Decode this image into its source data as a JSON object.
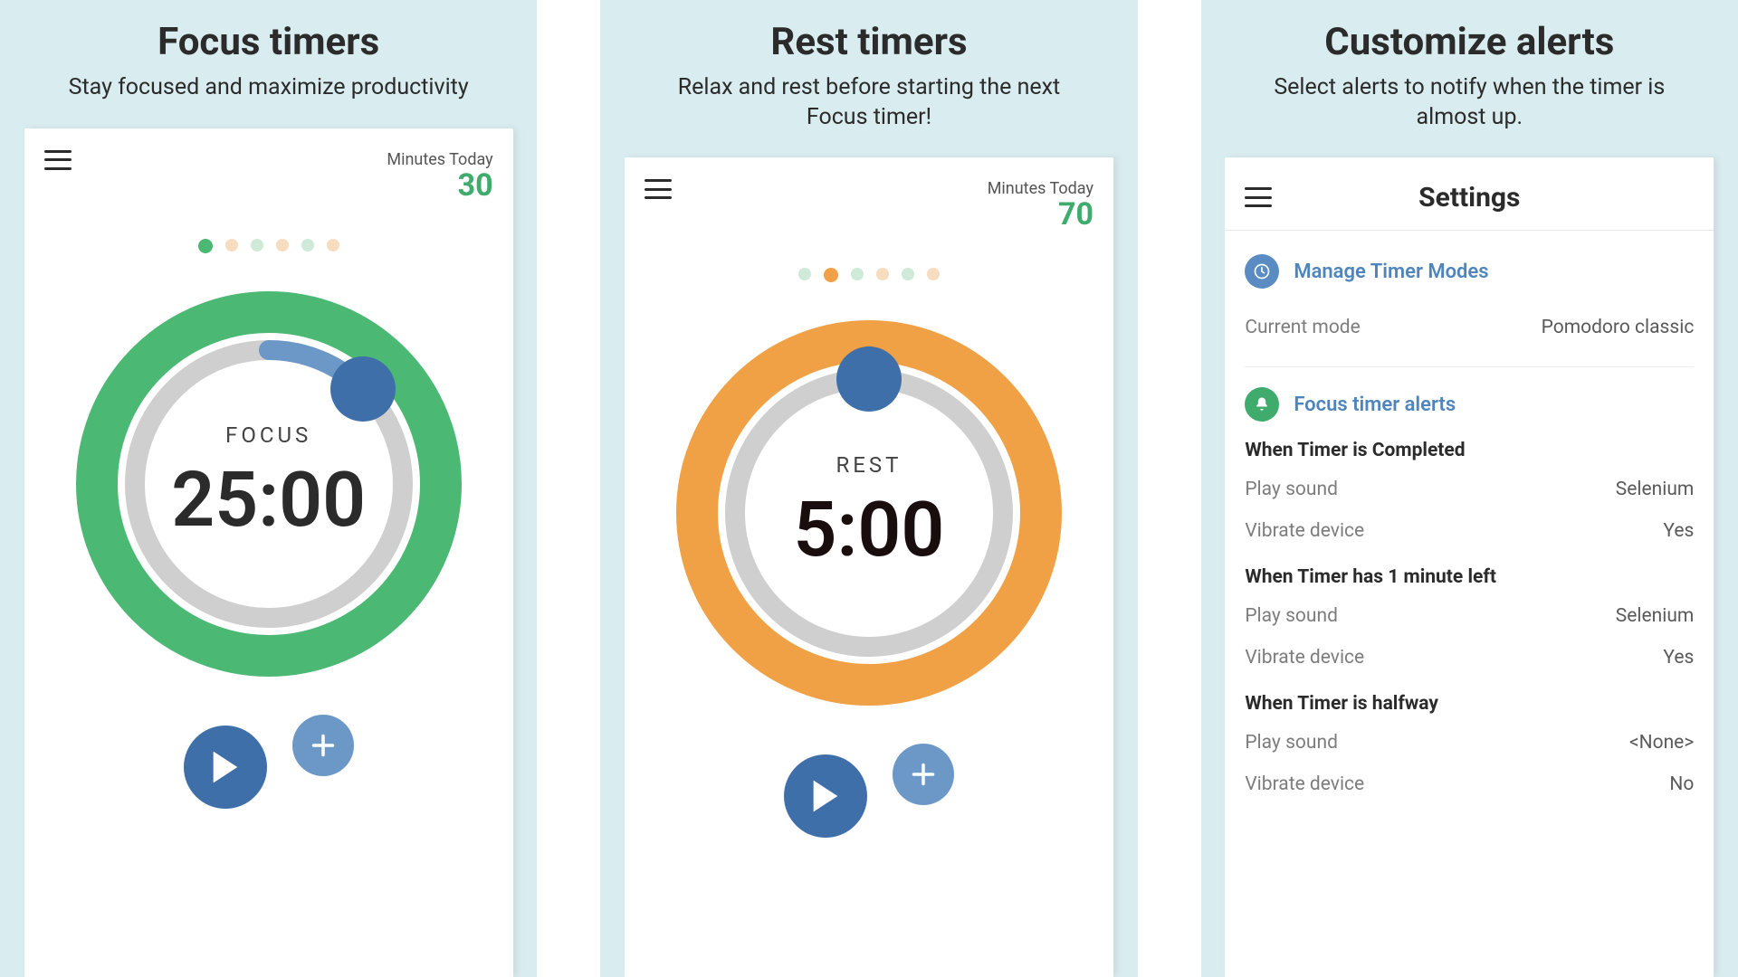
{
  "colors": {
    "green": "#4bb874",
    "orange": "#f0a146",
    "grey": "#cfcfcf",
    "blue": "#3f6fa8",
    "blueLight": "#6b98c6",
    "dotFadeGreen": "#cfead8",
    "dotFadeOrange": "#f7dcc0"
  },
  "panels": [
    {
      "title": "Focus timers",
      "subtitle": "Stay focused and maximize productivity",
      "minutesLabel": "Minutes Today",
      "minutesValue": "30",
      "dots": [
        "green",
        "fadeOrange",
        "fadeGreen",
        "fadeOrange",
        "fadeGreen",
        "fadeOrange"
      ],
      "timer": {
        "mode": "FOCUS",
        "time": "25:00",
        "ringColor": "green",
        "arcStart": 0,
        "arcEnd": 45,
        "knobDeg": 45
      }
    },
    {
      "title": "Rest timers",
      "subtitle": "Relax and rest before starting the next Focus timer!",
      "minutesLabel": "Minutes Today",
      "minutesValue": "70",
      "dots": [
        "fadeGreen",
        "orange",
        "fadeGreen",
        "fadeOrange",
        "fadeGreen",
        "fadeOrange"
      ],
      "timer": {
        "mode": "REST",
        "time": "5:00",
        "ringColor": "orange",
        "arcStart": 0,
        "arcEnd": 0,
        "knobDeg": 0
      }
    },
    {
      "title": "Customize alerts",
      "subtitle": "Select alerts to notify when the timer is almost up.",
      "settings": {
        "title": "Settings",
        "manage": {
          "link": "Manage Timer Modes",
          "label": "Current mode",
          "value": "Pomodoro classic"
        },
        "alerts": {
          "link": "Focus timer alerts",
          "groups": [
            {
              "heading": "When Timer is Completed",
              "rows": [
                {
                  "label": "Play sound",
                  "value": "Selenium"
                },
                {
                  "label": "Vibrate device",
                  "value": "Yes"
                }
              ]
            },
            {
              "heading": "When Timer has 1 minute left",
              "rows": [
                {
                  "label": "Play sound",
                  "value": "Selenium"
                },
                {
                  "label": "Vibrate device",
                  "value": "Yes"
                }
              ]
            },
            {
              "heading": "When Timer is halfway",
              "rows": [
                {
                  "label": "Play sound",
                  "value": "<None>"
                },
                {
                  "label": "Vibrate device",
                  "value": "No"
                }
              ]
            }
          ]
        }
      }
    }
  ]
}
